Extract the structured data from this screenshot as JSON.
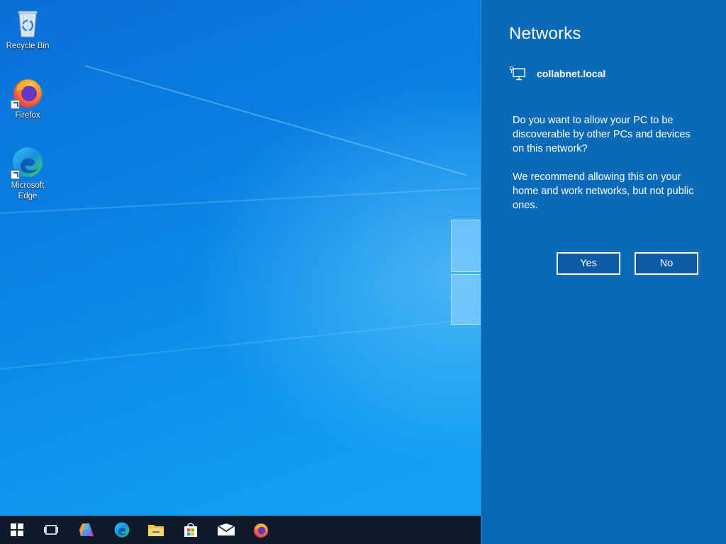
{
  "desktop": {
    "icons": [
      {
        "label": "Recycle Bin",
        "icon": "recycle-bin-icon"
      },
      {
        "label": "Firefox",
        "icon": "firefox-icon"
      },
      {
        "label": "Microsoft Edge",
        "icon": "edge-icon"
      }
    ]
  },
  "taskbar": {
    "items": [
      {
        "name": "Start",
        "icon": "windows-start-icon"
      },
      {
        "name": "Task View",
        "icon": "task-view-icon"
      },
      {
        "name": "Copilot",
        "icon": "copilot-icon"
      },
      {
        "name": "Microsoft Edge",
        "icon": "edge-icon"
      },
      {
        "name": "File Explorer",
        "icon": "folder-icon"
      },
      {
        "name": "Microsoft Store",
        "icon": "store-icon"
      },
      {
        "name": "Mail",
        "icon": "mail-icon"
      },
      {
        "name": "Firefox",
        "icon": "firefox-icon"
      }
    ]
  },
  "flyout": {
    "title": "Networks",
    "network_name": "collabnet.local",
    "network_icon": "ethernet-icon",
    "question": "Do you want to allow your PC to be discoverable by other PCs and devices on this network?",
    "recommendation": "We recommend allowing this on your home and work networks, but not public ones.",
    "yes_label": "Yes",
    "no_label": "No"
  },
  "colors": {
    "flyout_bg": "#0a6ab8",
    "desktop_blue": "#0b86e6",
    "taskbar_bg": "#0c1a2c"
  }
}
